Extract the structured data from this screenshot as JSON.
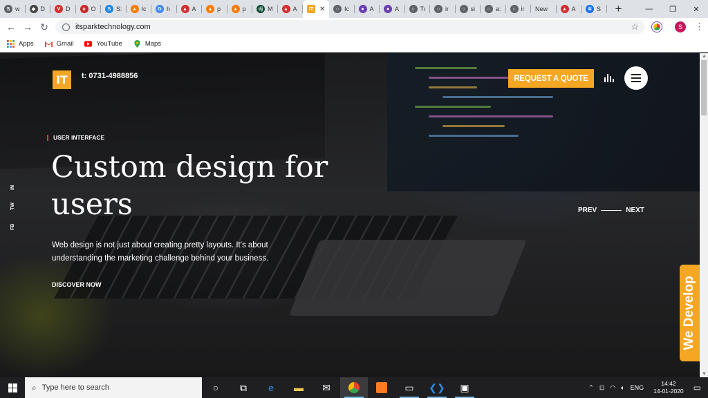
{
  "tabs": [
    {
      "label": "w",
      "color": "#5f6368",
      "glyph": "S"
    },
    {
      "label": "D",
      "color": "#444",
      "glyph": "◆"
    },
    {
      "label": "D",
      "color": "#d32f2f",
      "glyph": "V"
    },
    {
      "label": "O",
      "color": "#c62828",
      "glyph": "u"
    },
    {
      "label": "S:",
      "color": "#1e88e5",
      "glyph": "S"
    },
    {
      "label": "Ic",
      "color": "#f57c00",
      "glyph": "▲"
    },
    {
      "label": "h",
      "color": "#4285f4",
      "glyph": "G"
    },
    {
      "label": "A",
      "color": "#d32f2f",
      "glyph": "▲"
    },
    {
      "label": "p",
      "color": "#f57c00",
      "glyph": "▲"
    },
    {
      "label": "p",
      "color": "#f57c00",
      "glyph": "▲"
    },
    {
      "label": "M",
      "color": "#0c4b33",
      "glyph": "dj"
    },
    {
      "label": "A",
      "color": "#d32f2f",
      "glyph": "▲"
    },
    {
      "label": "",
      "color": "#f5a623",
      "glyph": "IT",
      "active": true
    },
    {
      "label": "Ic",
      "color": "#5f6368",
      "glyph": "○"
    },
    {
      "label": "A",
      "color": "#6a3fb0",
      "glyph": "●"
    },
    {
      "label": "A",
      "color": "#6a3fb0",
      "glyph": "●"
    },
    {
      "label": "Tı",
      "color": "#5f6368",
      "glyph": "○"
    },
    {
      "label": "ir",
      "color": "#5f6368",
      "glyph": "○"
    },
    {
      "label": "si",
      "color": "#5f6368",
      "glyph": "○"
    },
    {
      "label": "a:",
      "color": "#5f6368",
      "glyph": "○"
    },
    {
      "label": "ir",
      "color": "#5f6368",
      "glyph": "○"
    },
    {
      "label": "New",
      "color": "",
      "glyph": ""
    },
    {
      "label": "A",
      "color": "#d32f2f",
      "glyph": "▲"
    },
    {
      "label": "S",
      "color": "#1a73e8",
      "glyph": "✲"
    }
  ],
  "browser": {
    "url": "itsparktechnology.com",
    "avatar_letter": "S",
    "bookmarks": [
      {
        "label": "Apps",
        "color": "#4285f4"
      },
      {
        "label": "Gmail",
        "color": "#ea4335"
      },
      {
        "label": "YouTube",
        "color": "#ff0000"
      },
      {
        "label": "Maps",
        "color": "#34a853"
      }
    ]
  },
  "site": {
    "logo": "IT",
    "phone": "t: 0731-4988856",
    "quote_button": "REQUEST A QUOTE",
    "social": [
      "IN",
      "TW",
      "FB"
    ],
    "eyebrow": "USER INTERFACE",
    "headline": "Custom design for users",
    "description": "Web design is not just about creating pretty layouts. It's about understanding the marketing challenge behind your business.",
    "cta": "DISCOVER NOW",
    "prev": "PREV",
    "next": "NEXT",
    "side_tab": "We Develop"
  },
  "taskbar": {
    "search_placeholder": "Type here to search",
    "language": "ENG",
    "time": "14:42",
    "date": "14-01-2020"
  }
}
